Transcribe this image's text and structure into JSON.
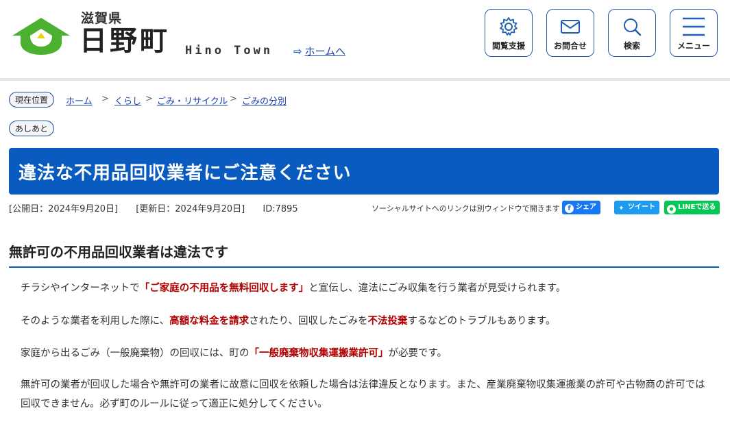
{
  "header": {
    "pref_name": "滋賀県",
    "town_name": "日野町",
    "english_name": "Hino Town",
    "home_link": "ホームへ",
    "buttons": [
      {
        "label": "閲覧支援",
        "icon": "gear-icon"
      },
      {
        "label": "お問合せ",
        "icon": "mail-icon"
      },
      {
        "label": "検索",
        "icon": "search-icon"
      },
      {
        "label": "メニュー",
        "icon": "hamburger-icon"
      }
    ]
  },
  "breadcrumb": {
    "label": "現在位置",
    "items": [
      "ホーム",
      "くらし",
      "ごみ・リサイクル",
      "ごみの分別"
    ]
  },
  "ashiato": "あしあと",
  "page_title": "違法な不用品回収業者にご注意ください",
  "meta": {
    "published": "[公開日：2024年9月20日]",
    "updated": "[更新日：2024年9月20日]",
    "id": "ID:7895"
  },
  "social": {
    "note": "ソーシャルサイトへのリンクは別ウィンドウで開きます",
    "facebook": "シェア",
    "twitter": "ツイート",
    "line": "LINEで送る"
  },
  "section_heading": "無許可の不用品回収業者は違法です",
  "paragraphs": {
    "p1": {
      "a": "チラシやインターネットで",
      "em": "「ご家庭の不用品を無料回収します」",
      "b": "と宣伝し、違法にごみ収集を行う業者が見受けられます。"
    },
    "p2": {
      "a": "そのような業者を利用した際に、",
      "em1": "高額な料金を請求",
      "b": "されたり、回収したごみを",
      "em2": "不法投棄",
      "c": "するなどのトラブルもあります。"
    },
    "p3": {
      "a": "家庭から出るごみ（一般廃棄物）の回収には、町の",
      "em": "「一般廃棄物収集運搬業許可」",
      "b": "が必要です。"
    },
    "p4": "無許可の業者が回収した場合や無許可の業者に故意に回収を依頼した場合は法律違反となります。また、産業廃棄物収集運搬業の許可や古物商の許可では回収できません。必ず町のルールに従って適正に処分してください。"
  },
  "colors": {
    "accent": "#0a5bbf",
    "emphasis": "#b00000",
    "logo_green": "#4cb030"
  }
}
